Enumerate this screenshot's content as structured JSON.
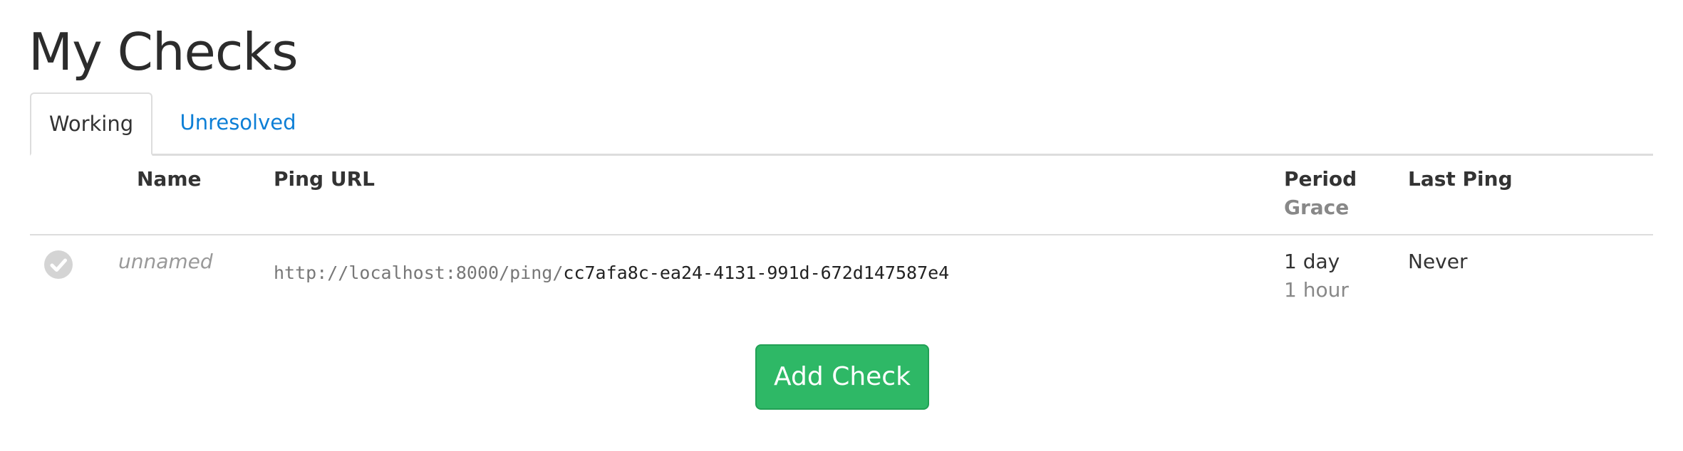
{
  "page": {
    "title": "My Checks"
  },
  "tabs": [
    {
      "label": "Working",
      "active": true
    },
    {
      "label": "Unresolved",
      "active": false
    }
  ],
  "table": {
    "headers": {
      "name": "Name",
      "ping_url": "Ping URL",
      "period": "Period",
      "grace": "Grace",
      "last_ping": "Last Ping"
    },
    "rows": [
      {
        "status_icon": "check-circle-icon",
        "name": "unnamed",
        "ping_url_base": "http://localhost:8000/ping/",
        "ping_url_code": "cc7afa8c-ea24-4131-991d-672d147587e4",
        "period": "1 day",
        "grace": "1 hour",
        "last_ping": "Never"
      }
    ]
  },
  "actions": {
    "add_check_label": "Add Check"
  },
  "colors": {
    "tab_link": "#0d7fd6",
    "add_button": "#2eb866",
    "status_icon": "#d4d4d4"
  }
}
